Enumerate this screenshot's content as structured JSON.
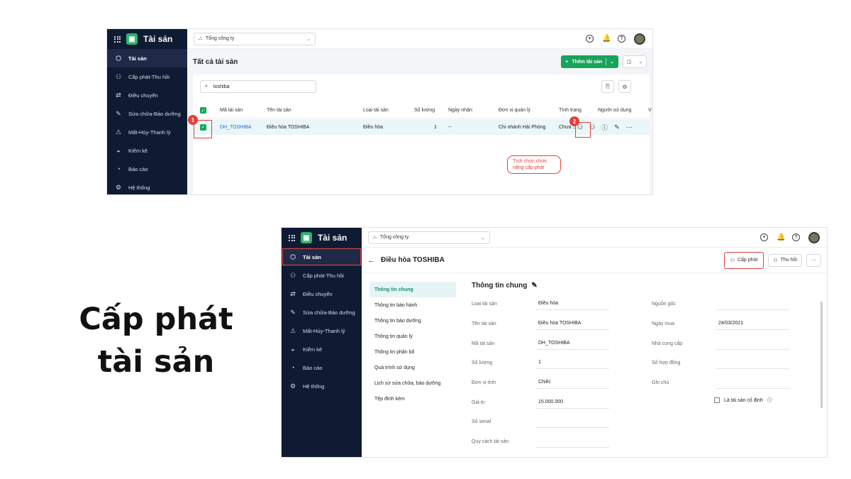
{
  "brand_name": "Tài sản",
  "org_select": "Tổng công ty",
  "nav": [
    {
      "label": "Tài sản",
      "icon": "box-icon"
    },
    {
      "label": "Cấp phát-Thu hồi",
      "icon": "user-assign-icon"
    },
    {
      "label": "Điều chuyển",
      "icon": "transfer-icon"
    },
    {
      "label": "Sửa chữa-Bảo dưỡng",
      "icon": "wrench-icon"
    },
    {
      "label": "Mất-Hủy-Thanh lý",
      "icon": "warning-icon"
    },
    {
      "label": "Kiểm kê",
      "icon": "inbox-icon"
    },
    {
      "label": "Báo cáo",
      "icon": "pie-chart-icon"
    },
    {
      "label": "Hệ thống",
      "icon": "gear-icon"
    }
  ],
  "list": {
    "title": "Tất cả tài sản",
    "add_button": "Thêm tài sản",
    "search_value": "toshiba",
    "columns": [
      "Mã tài sản",
      "Tên tài sản",
      "Loại tài sản",
      "Số lượng",
      "Ngày nhận",
      "Đơn vị quản lý",
      "Tình trạng",
      "Người sử dụng",
      "V"
    ],
    "row": {
      "code": "DH_TOSHIBA",
      "name": "Điều hòa TOSHIBA",
      "type": "Điều hòa",
      "qty": "1",
      "received": "--",
      "unit": "Chi nhánh Hải Phòng",
      "status": "Chưa ..."
    },
    "marker1": "1",
    "marker2": "2",
    "callout_line1": "Tích chọn chức",
    "callout_line2": "năng cấp phát"
  },
  "big_title_line1": "Cấp phát",
  "big_title_line2": "tài sản",
  "detail": {
    "title": "Điều hòa TOSHIBA",
    "assign_button": "Cấp phát",
    "revoke_button": "Thu hồi",
    "more_button": "···",
    "subnav": [
      "Thông tin chung",
      "Thông tin bảo hành",
      "Thông tin bảo dưỡng",
      "Thông tin quản lý",
      "Thông tin phân bổ",
      "Quá trình sử dụng",
      "Lịch sử sửa chữa, bảo dưỡng",
      "Tệp đính kèm"
    ],
    "form_title": "Thông tin chung",
    "left_fields": [
      {
        "label": "Loại tài sản",
        "value": "Điều hòa"
      },
      {
        "label": "Tên tài sản",
        "value": "Điều hòa TOSHIBA"
      },
      {
        "label": "Mã tài sản",
        "value": "DH_TOSHIBA"
      },
      {
        "label": "Số lượng",
        "value": "1"
      },
      {
        "label": "Đơn vị tính",
        "value": "Chiếc"
      },
      {
        "label": "Giá trị",
        "value": "15.000.000"
      },
      {
        "label": "Số serial",
        "value": ""
      },
      {
        "label": "Quy cách tài sản",
        "value": ""
      }
    ],
    "right_fields": [
      {
        "label": "Nguồn gốc",
        "value": ""
      },
      {
        "label": "Ngày mua",
        "value": "24/03/2021"
      },
      {
        "label": "Nhà cung cấp",
        "value": ""
      },
      {
        "label": "Số hợp đồng",
        "value": ""
      },
      {
        "label": "Ghi chú",
        "value": ""
      }
    ],
    "fixed_asset_label": "Là tài sản cố định"
  },
  "colors": {
    "sidebar": "#0f1a33",
    "accent": "#17a45a",
    "highlight": "#e0413a",
    "link": "#2a6bd1"
  }
}
